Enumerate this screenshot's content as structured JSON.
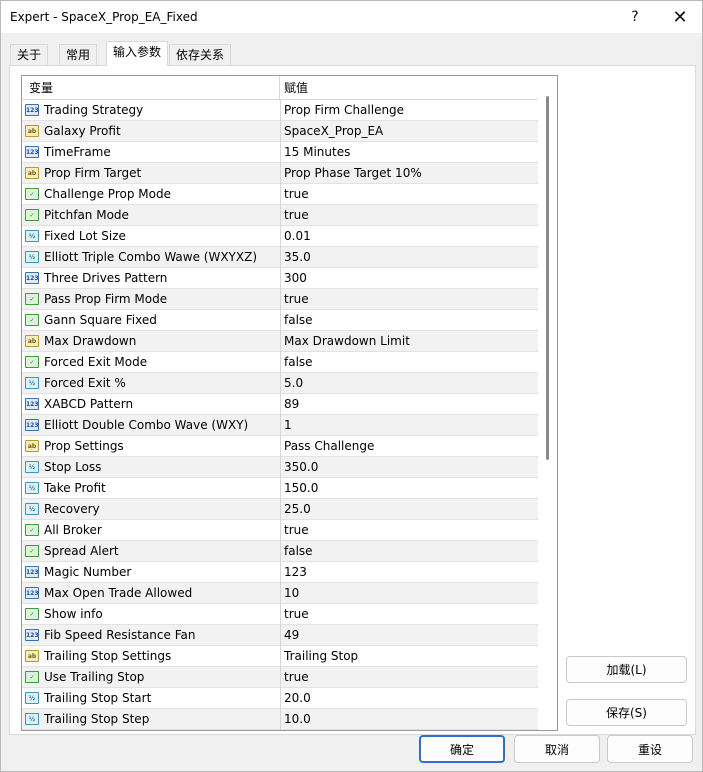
{
  "window": {
    "title": "Expert - SpaceX_Prop_EA_Fixed",
    "help_label": "?",
    "close_label": "✕"
  },
  "tabs": [
    {
      "label": "关于",
      "active": false
    },
    {
      "label": "常用",
      "active": false
    },
    {
      "label": "输入参数",
      "active": true
    },
    {
      "label": "依存关系",
      "active": false
    }
  ],
  "grid": {
    "header_variable": "变量",
    "header_value": "赋值",
    "rows": [
      {
        "type": "int",
        "icon_text": "123",
        "name": "Trading Strategy",
        "value": "Prop Firm Challenge"
      },
      {
        "type": "str",
        "icon_text": "ab",
        "name": "Galaxy Profit",
        "value": "SpaceX_Prop_EA"
      },
      {
        "type": "int",
        "icon_text": "123",
        "name": "TimeFrame",
        "value": "15 Minutes"
      },
      {
        "type": "str",
        "icon_text": "ab",
        "name": "Prop Firm Target",
        "value": "Prop Phase Target 10%"
      },
      {
        "type": "bool",
        "icon_text": "✓",
        "name": "Challenge Prop Mode",
        "value": "true"
      },
      {
        "type": "bool",
        "icon_text": "✓",
        "name": "Pitchfan Mode",
        "value": "true"
      },
      {
        "type": "dbl",
        "icon_text": "½",
        "name": "Fixed Lot Size",
        "value": "0.01"
      },
      {
        "type": "dbl",
        "icon_text": "½",
        "name": "Elliott Triple Combo Wawe (WXYXZ)",
        "value": "35.0"
      },
      {
        "type": "int",
        "icon_text": "123",
        "name": "Three Drives Pattern",
        "value": "300"
      },
      {
        "type": "bool",
        "icon_text": "✓",
        "name": "Pass Prop Firm Mode",
        "value": "true"
      },
      {
        "type": "bool",
        "icon_text": "✓",
        "name": "Gann Square Fixed",
        "value": "false"
      },
      {
        "type": "str",
        "icon_text": "ab",
        "name": "Max Drawdown",
        "value": " Max Drawdown Limit"
      },
      {
        "type": "bool",
        "icon_text": "✓",
        "name": "Forced Exit Mode",
        "value": "false"
      },
      {
        "type": "dbl",
        "icon_text": "½",
        "name": "Forced Exit %",
        "value": "5.0"
      },
      {
        "type": "int",
        "icon_text": "123",
        "name": "XABCD Pattern",
        "value": "89"
      },
      {
        "type": "int",
        "icon_text": "123",
        "name": "Elliott Double Combo Wave (WXY)",
        "value": "1"
      },
      {
        "type": "str",
        "icon_text": "ab",
        "name": "Prop Settings",
        "value": "Pass Challenge"
      },
      {
        "type": "dbl",
        "icon_text": "½",
        "name": "Stop Loss",
        "value": "350.0"
      },
      {
        "type": "dbl",
        "icon_text": "½",
        "name": "Take Profit",
        "value": "150.0"
      },
      {
        "type": "dbl",
        "icon_text": "½",
        "name": "Recovery",
        "value": "25.0"
      },
      {
        "type": "bool",
        "icon_text": "✓",
        "name": "All Broker",
        "value": "true"
      },
      {
        "type": "bool",
        "icon_text": "✓",
        "name": "Spread Alert",
        "value": "false"
      },
      {
        "type": "int",
        "icon_text": "123",
        "name": "Magic Number",
        "value": "123"
      },
      {
        "type": "int",
        "icon_text": "123",
        "name": "Max Open Trade Allowed",
        "value": "10"
      },
      {
        "type": "bool",
        "icon_text": "✓",
        "name": "Show info",
        "value": "true"
      },
      {
        "type": "int",
        "icon_text": "123",
        "name": "Fib Speed Resistance Fan",
        "value": "49"
      },
      {
        "type": "str",
        "icon_text": "ab",
        "name": "Trailing Stop Settings",
        "value": " Trailing Stop"
      },
      {
        "type": "bool",
        "icon_text": "✓",
        "name": "Use Trailing Stop",
        "value": "true"
      },
      {
        "type": "dbl",
        "icon_text": "½",
        "name": "Trailing Stop Start",
        "value": "20.0"
      },
      {
        "type": "dbl",
        "icon_text": "½",
        "name": "Trailing Stop Step",
        "value": "10.0"
      }
    ]
  },
  "buttons": {
    "load": "加载(L)",
    "save": "保存(S)",
    "ok": "确定",
    "cancel": "取消",
    "reset": "重设"
  }
}
